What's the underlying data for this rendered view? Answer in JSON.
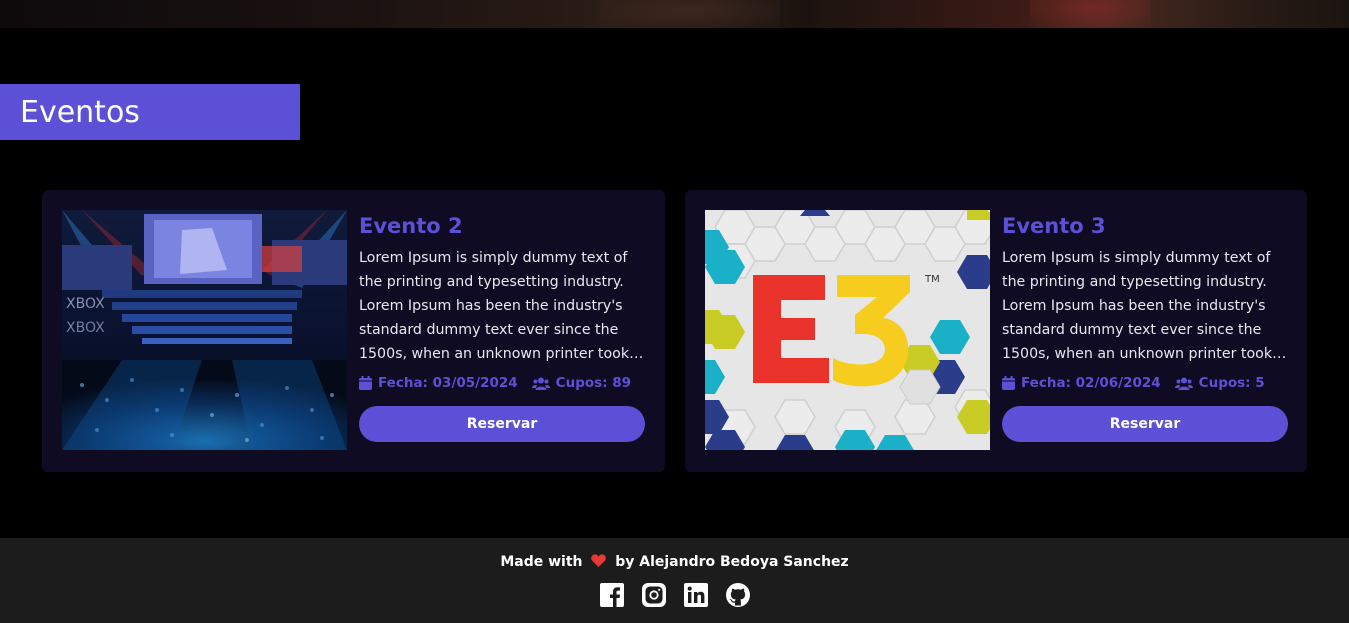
{
  "section": {
    "title": "Eventos"
  },
  "events": [
    {
      "title": "Evento 2",
      "description": "Lorem Ipsum is simply dummy text of the printing and typesetting industry. Lorem Ipsum has been the industry's standard dummy text ever since the 1500s, when an unknown printer took a galley of type and scrambled it to make a type specimen book.",
      "date": "Fecha: 03/05/2024",
      "seats": "Cupos: 89",
      "button": "Reservar",
      "image_alt": "xbox-stage-event-photo"
    },
    {
      "title": "Evento 3",
      "description": "Lorem Ipsum is simply dummy text of the printing and typesetting industry. Lorem Ipsum has been the industry's standard dummy text ever since the 1500s, when an unknown printer took a galley of type and scrambled it to make a type specimen book.",
      "date": "Fecha: 02/06/2024",
      "seats": "Cupos: 5",
      "button": "Reservar",
      "image_alt": "e3-logo-image",
      "logo_text": "E3",
      "logo_tm": "TM"
    }
  ],
  "footer": {
    "made_with": "Made with",
    "by": "by Alejandro Bedoya Sanchez",
    "socials": [
      "facebook-icon",
      "instagram-icon",
      "linkedin-icon",
      "github-icon"
    ]
  },
  "colors": {
    "accent": "#5b50d6",
    "card_bg": "#0e0b23",
    "footer_bg": "#1c1c1c",
    "heart": "#e53935"
  }
}
